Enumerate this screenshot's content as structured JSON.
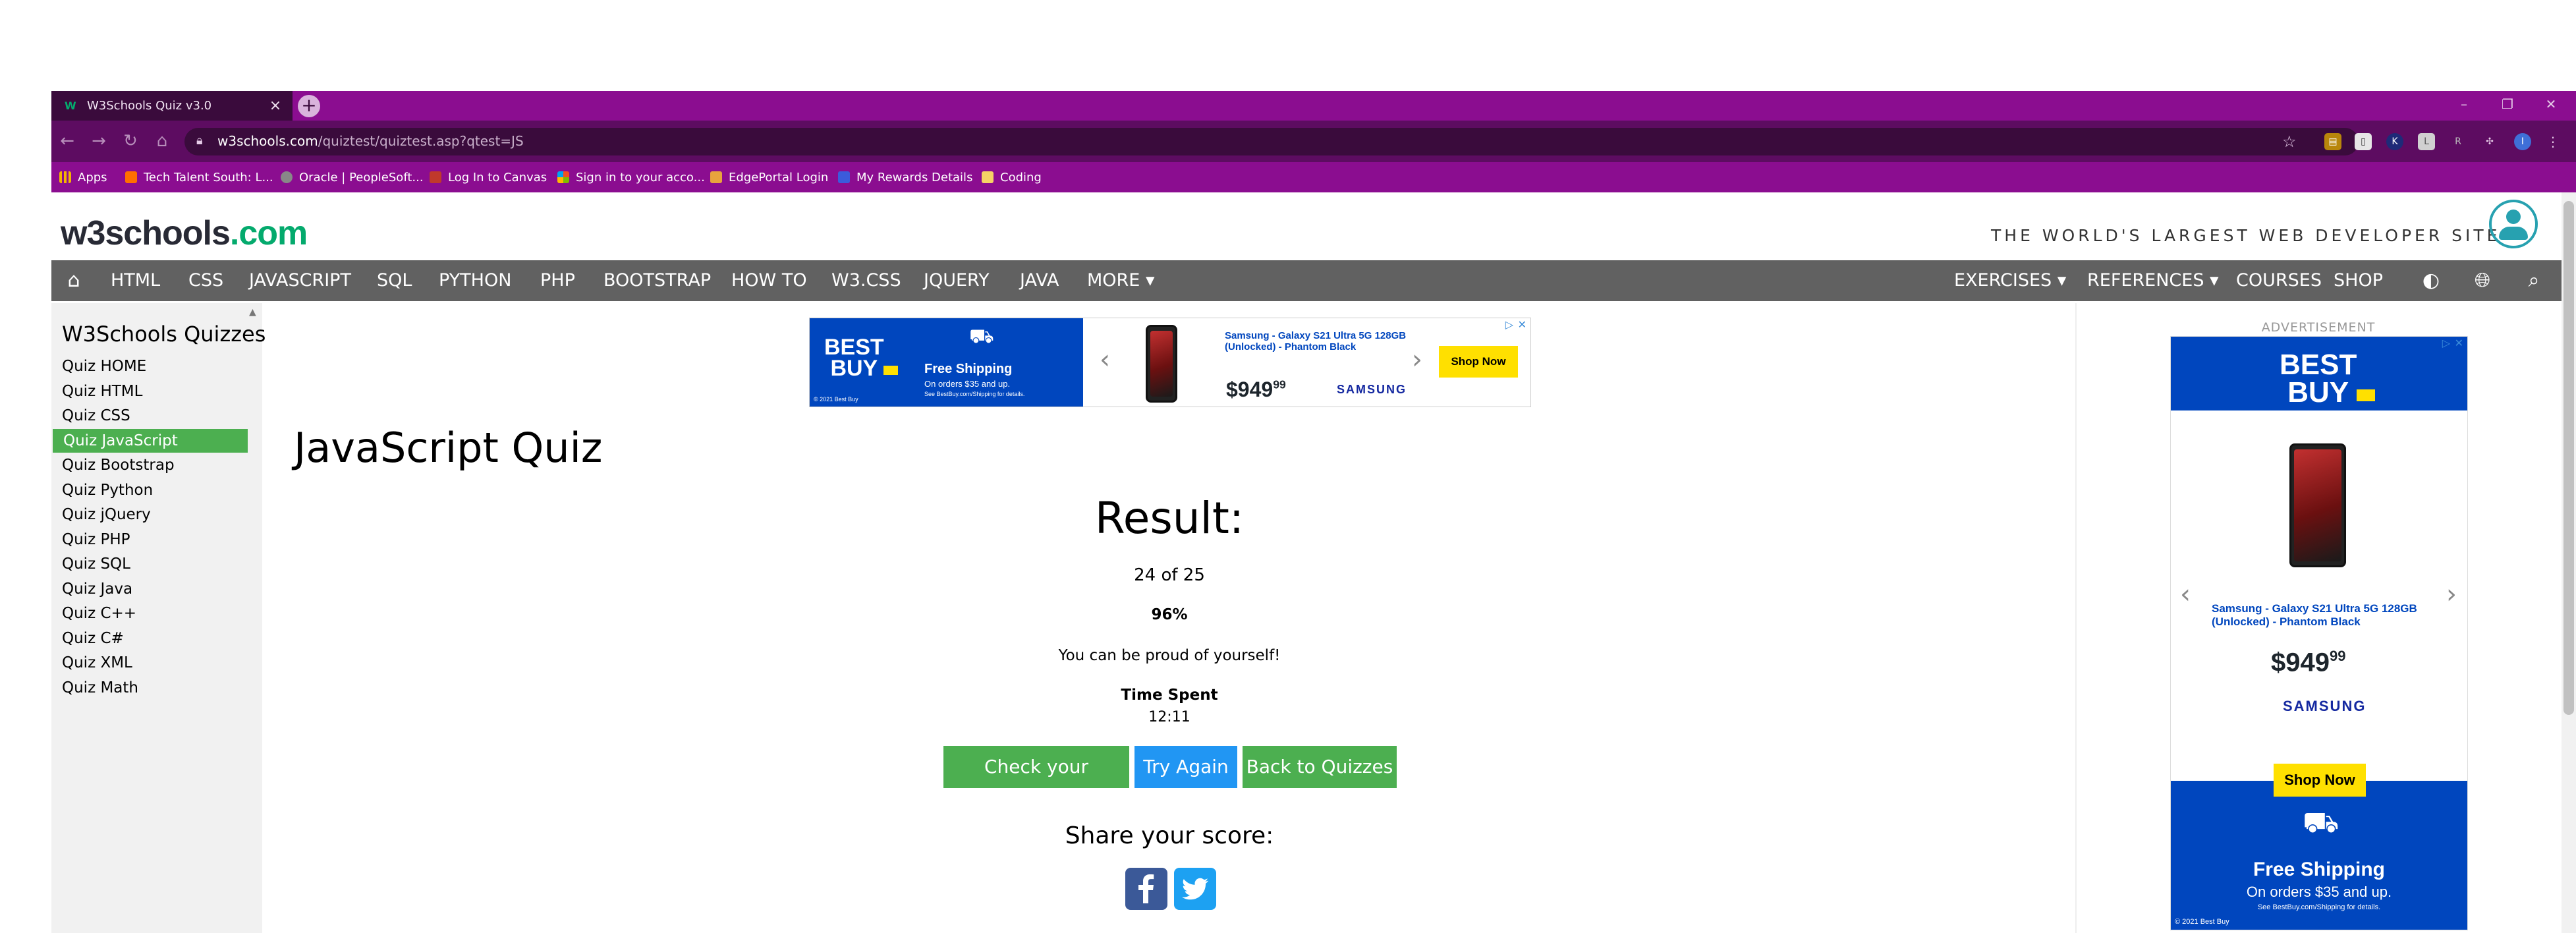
{
  "browser": {
    "tab_title": "W3Schools Quiz v3.0",
    "tab_close": "×",
    "new_tab": "+",
    "url_host": "w3schools.com",
    "url_path": "/quiztest/quiztest.asp?qtest=JS",
    "bookmarks": [
      "Apps",
      "Tech Talent South: L...",
      "Oracle | PeopleSoft...",
      "Log In to Canvas",
      "Sign in to your acco...",
      "EdgePortal Login",
      "My Rewards Details",
      "Coding"
    ],
    "profile_initial": "I"
  },
  "site": {
    "logo_main": "w3schools",
    "logo_suffix": ".com",
    "tagline": "THE WORLD'S LARGEST WEB DEVELOPER SITE"
  },
  "topnav": {
    "left": [
      "HTML",
      "CSS",
      "JAVASCRIPT",
      "SQL",
      "PYTHON",
      "PHP",
      "BOOTSTRAP",
      "HOW TO",
      "W3.CSS",
      "JQUERY",
      "JAVA",
      "MORE ▾"
    ],
    "right": [
      "EXERCISES ▾",
      "REFERENCES ▾",
      "COURSES",
      "SHOP"
    ]
  },
  "sidebar": {
    "title": "W3Schools Quizzes",
    "items": [
      "Quiz HOME",
      "Quiz HTML",
      "Quiz CSS",
      "Quiz JavaScript",
      "Quiz Bootstrap",
      "Quiz Python",
      "Quiz jQuery",
      "Quiz PHP",
      "Quiz SQL",
      "Quiz Java",
      "Quiz C++",
      "Quiz C#",
      "Quiz XML",
      "Quiz Math"
    ],
    "active_index": 3
  },
  "main": {
    "heading": "JavaScript Quiz",
    "result_label": "Result:",
    "score": "24 of 25",
    "percent": "96%",
    "message": "You can be proud of yourself!",
    "time_label": "Time Spent",
    "time_value": "12:11",
    "buttons": {
      "check": "Check your answers",
      "try_again": "Try Again",
      "back": "Back to Quizzes"
    },
    "share_label": "Share your score:"
  },
  "ads": {
    "label": "ADVERTISEMENT",
    "brand_line1": "BEST",
    "brand_line2": "BUY",
    "free_shipping": "Free Shipping",
    "orders": "On orders $35 and up.",
    "see": "See BestBuy.com/Shipping for details.",
    "copyright": "© 2021 Best Buy",
    "product": "Samsung - Galaxy S21 Ultra 5G 128GB (Unlocked) - Phantom Black",
    "price_whole": "$949",
    "price_cents": "99",
    "maker": "SAMSUNG",
    "cta": "Shop Now"
  },
  "colors": {
    "accent_green": "#4caf50",
    "try_blue": "#2196f3",
    "topnav_gray": "#616161",
    "browser_purple": "#8b0d90"
  }
}
